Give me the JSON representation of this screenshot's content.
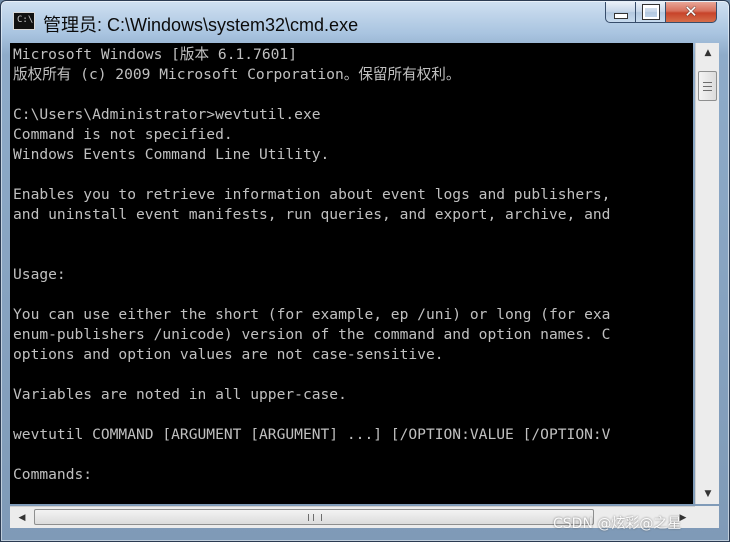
{
  "window": {
    "title": "管理员: C:\\Windows\\system32\\cmd.exe",
    "icon": "cmd-icon",
    "icon_prompt": "C:\\",
    "caption": {
      "minimize": "minimize-icon",
      "maximize": "maximize-icon",
      "close": "✕"
    }
  },
  "console": {
    "lines": [
      "Microsoft Windows [版本 6.1.7601]",
      "版权所有 (c) 2009 Microsoft Corporation。保留所有权利。",
      "",
      "C:\\Users\\Administrator>wevtutil.exe",
      "Command is not specified.",
      "Windows Events Command Line Utility.",
      "",
      "Enables you to retrieve information about event logs and publishers,",
      "and uninstall event manifests, run queries, and export, archive, and",
      "",
      "",
      "Usage:",
      "",
      "You can use either the short (for example, ep /uni) or long (for exa",
      "enum-publishers /unicode) version of the command and option names. C",
      "options and option values are not case-sensitive.",
      "",
      "Variables are noted in all upper-case.",
      "",
      "wevtutil COMMAND [ARGUMENT [ARGUMENT] ...] [/OPTION:VALUE [/OPTION:V",
      "",
      "Commands:",
      ""
    ]
  },
  "scrollbars": {
    "vertical": {
      "up": "▲",
      "down": "▼"
    },
    "horizontal": {
      "left": "◀",
      "right": "▶"
    }
  },
  "watermark": "CSDN @炫彩@之星"
}
